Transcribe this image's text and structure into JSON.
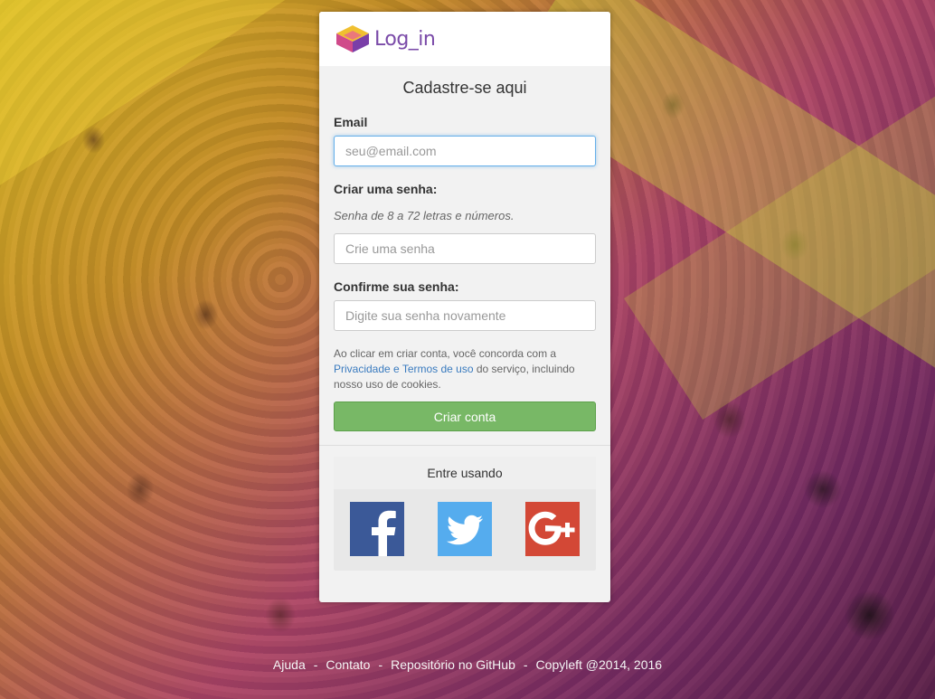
{
  "app": {
    "logo_text": "Log_in",
    "page_title": "Cadastre-se aqui"
  },
  "form": {
    "email_label": "Email",
    "email_placeholder": "seu@email.com",
    "password_label": "Criar uma senha:",
    "password_hint": "Senha de 8 a 72 letras e números.",
    "password_placeholder": "Crie uma senha",
    "confirm_label": "Confirme sua senha:",
    "confirm_placeholder": "Digite sua senha novamente",
    "terms_prefix": "Ao clicar em criar conta, você concorda com a",
    "terms_link": "Privacidade e Termos de uso",
    "terms_suffix": "do serviço, incluindo nosso uso de cookies.",
    "submit_label": "Criar conta"
  },
  "social": {
    "heading": "Entre usando",
    "providers": [
      {
        "name": "facebook",
        "icon": "facebook-icon",
        "color": "#3b5998"
      },
      {
        "name": "twitter",
        "icon": "twitter-icon",
        "color": "#55acee"
      },
      {
        "name": "google-plus",
        "icon": "google-plus-icon",
        "color": "#d34836"
      }
    ]
  },
  "footer": {
    "help": "Ajuda",
    "contact": "Contato",
    "repo": "Repositório no GitHub",
    "copyleft": "Copyleft @2014, 2016",
    "separator": "-"
  },
  "colors": {
    "primary_button": "#78b866",
    "link": "#3a7bbf",
    "logo": "#7a4aa8"
  }
}
